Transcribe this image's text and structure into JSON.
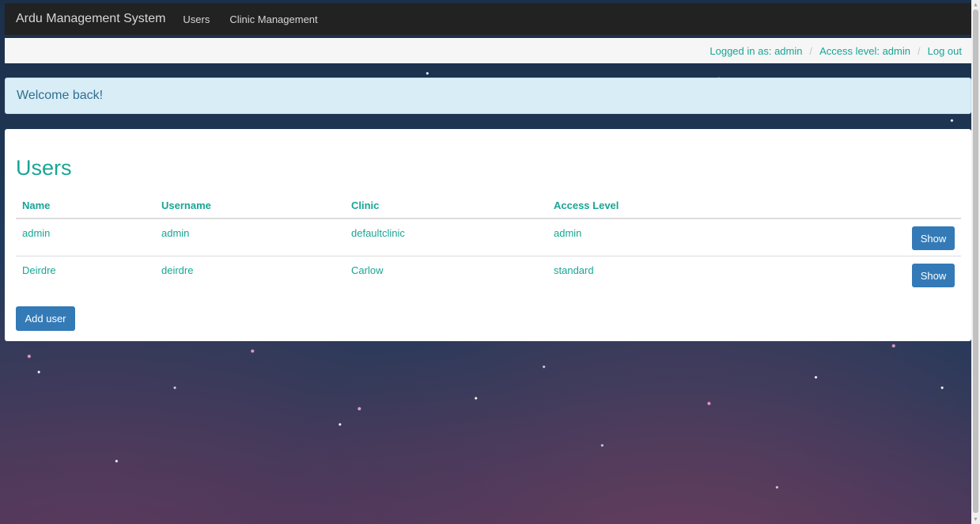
{
  "navbar": {
    "brand": "Ardu Management System",
    "links": [
      "Users",
      "Clinic Management"
    ]
  },
  "status": {
    "logged_in": "Logged in as: admin",
    "access_level": "Access level: admin",
    "logout": "Log out",
    "separator": "/"
  },
  "alert": {
    "message": "Welcome back!"
  },
  "users": {
    "title": "Users",
    "columns": [
      "Name",
      "Username",
      "Clinic",
      "Access Level"
    ],
    "rows": [
      {
        "name": "admin",
        "username": "admin",
        "clinic": "defaultclinic",
        "access": "admin",
        "action": "Show"
      },
      {
        "name": "Deirdre",
        "username": "deirdre",
        "clinic": "Carlow",
        "access": "standard",
        "action": "Show"
      }
    ],
    "add_button": "Add user"
  },
  "colors": {
    "accent": "#18a595",
    "button": "#337ab7",
    "navbar": "#222222",
    "alert_bg": "#d9edf7"
  },
  "icons": {
    "scroll_up": "triangle-up-icon",
    "scroll_down": "triangle-down-icon"
  }
}
